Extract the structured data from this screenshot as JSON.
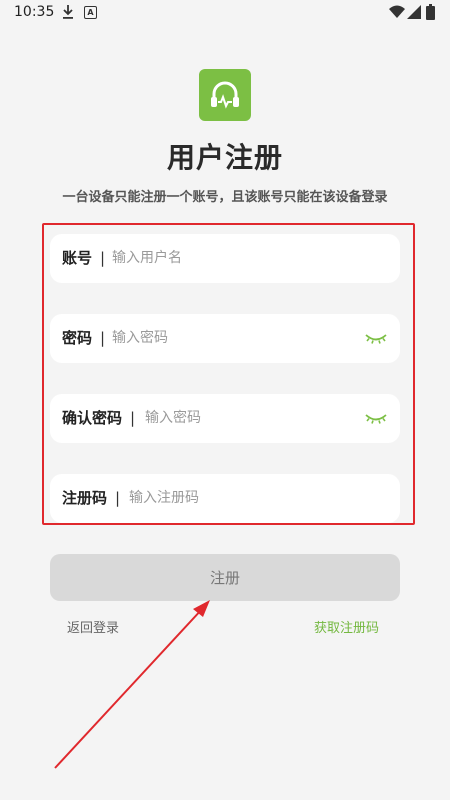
{
  "status_bar": {
    "time": "10:35",
    "icons": [
      "download-icon",
      "a-icon",
      "wifi-icon",
      "signal-icon",
      "battery-icon"
    ],
    "a_glyph": "A"
  },
  "header": {
    "logo_icon": "headphone-icon",
    "title": "用户注册",
    "subtitle": "一台设备只能注册一个账号，且该账号只能在该设备登录"
  },
  "form": {
    "fields": [
      {
        "label": "账号",
        "separator": "|",
        "placeholder": "输入用户名",
        "value": ""
      },
      {
        "label": "密码",
        "separator": "|",
        "placeholder": "输入密码",
        "value": "",
        "icon": "eye-closed-icon"
      },
      {
        "label": "确认密码",
        "separator": "|",
        "placeholder": "输入密码",
        "value": "",
        "icon": "eye-closed-icon"
      },
      {
        "label": "注册码",
        "separator": "|",
        "placeholder": "输入注册码",
        "value": ""
      }
    ]
  },
  "actions": {
    "register_label": "注册",
    "back_login_label": "返回登录",
    "get_code_label": "获取注册码"
  },
  "colors": {
    "accent": "#7cbf44",
    "link_accent": "#74b840",
    "highlight_frame": "#e0282d",
    "button_disabled": "#d9d9d9"
  }
}
